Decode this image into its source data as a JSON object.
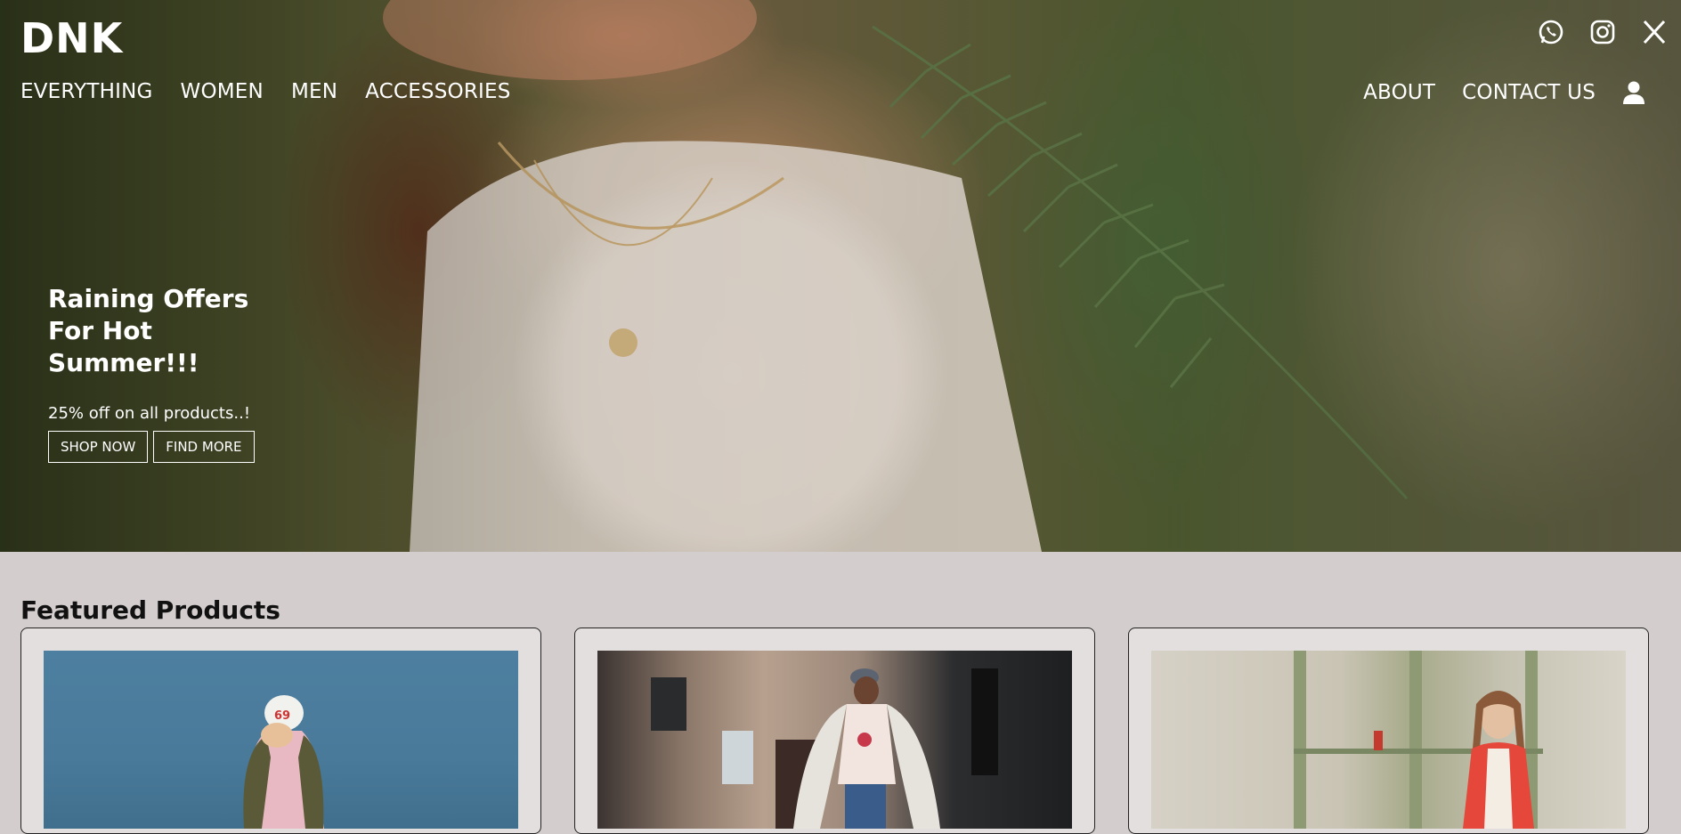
{
  "header": {
    "brand": "DNK",
    "nav_left": [
      "EVERYTHING",
      "WOMEN",
      "MEN",
      "ACCESSORIES"
    ],
    "nav_right": [
      "ABOUT",
      "CONTACT US"
    ],
    "social_icons": [
      "whatsapp-icon",
      "instagram-icon",
      "x-icon"
    ],
    "account_icon": "user-icon"
  },
  "hero": {
    "heading": "Raining Offers For Hot Summer!!!",
    "subtext": "25% off on all products..!",
    "shop_now": "SHOP NOW",
    "find_more": "FIND MORE"
  },
  "featured": {
    "title": "Featured Products"
  },
  "colors": {
    "page_bg": "#d3cdcd",
    "card_bg": "#e3dfdf",
    "hero_text": "#ffffff"
  }
}
